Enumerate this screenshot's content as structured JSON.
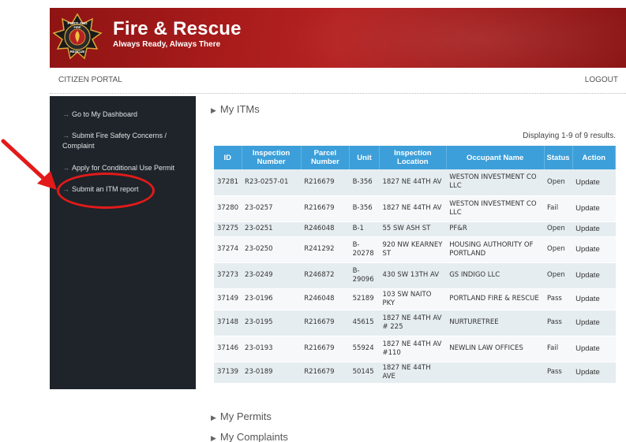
{
  "header": {
    "logo_text": [
      "PORTLAND",
      "FIRE",
      "RESCUE"
    ],
    "title": "Fire & Rescue",
    "tagline": "Always Ready, Always There"
  },
  "subnav": {
    "portal_label": "CITIZEN PORTAL",
    "logout_label": "LOGOUT"
  },
  "sidebar": {
    "items": [
      {
        "label": "Go to My Dashboard"
      },
      {
        "label": "Submit Fire Safety Concerns / Complaint"
      },
      {
        "label": "Apply for Conditional Use Permit"
      },
      {
        "label": "Submit an ITM report"
      }
    ]
  },
  "annotation": {
    "color": "#e21a1a"
  },
  "main": {
    "itms_title": "My ITMs",
    "results_info": "Displaying 1-9 of 9 results.",
    "columns": [
      "ID",
      "Inspection Number",
      "Parcel Number",
      "Unit",
      "Inspection Location",
      "Occupant Name",
      "Status",
      "Action"
    ],
    "rows": [
      [
        "37281",
        "R23-0257-01",
        "R216679",
        "B-356",
        "1827 NE 44TH AV",
        "WESTON INVESTMENT CO LLC",
        "Open",
        "Update"
      ],
      [
        "37280",
        "23-0257",
        "R216679",
        "B-356",
        "1827 NE 44TH AV",
        "WESTON INVESTMENT CO LLC",
        "Fail",
        "Update"
      ],
      [
        "37275",
        "23-0251",
        "R246048",
        "B-1",
        "55 SW ASH ST",
        "PF&R",
        "Open",
        "Update"
      ],
      [
        "37274",
        "23-0250",
        "R241292",
        "B-20278",
        "920 NW KEARNEY ST",
        "HOUSING AUTHORITY OF PORTLAND",
        "Open",
        "Update"
      ],
      [
        "37273",
        "23-0249",
        "R246872",
        "B-29096",
        "430 SW 13TH AV",
        "GS INDIGO LLC",
        "Open",
        "Update"
      ],
      [
        "37149",
        "23-0196",
        "R246048",
        "52189",
        "103 SW NAITO PKY",
        "PORTLAND FIRE & RESCUE",
        "Pass",
        "Update"
      ],
      [
        "37148",
        "23-0195",
        "R216679",
        "45615",
        "1827 NE 44TH AV # 225",
        "NURTURETREE",
        "Pass",
        "Update"
      ],
      [
        "37146",
        "23-0193",
        "R216679",
        "55924",
        "1827 NE 44TH AV #110",
        "NEWLIN LAW OFFICES",
        "Fail",
        "Update"
      ],
      [
        "37139",
        "23-0189",
        "R216679",
        "50145",
        "1827 NE 44TH AVE",
        "",
        "Pass",
        "Update"
      ]
    ],
    "permits_title": "My Permits",
    "complaints_title": "My Complaints"
  },
  "colors": {
    "banner_red": "#a81b1b",
    "sidebar_bg": "#1e2429",
    "table_header": "#3c9fd9",
    "link_blue": "#2b88c8"
  }
}
